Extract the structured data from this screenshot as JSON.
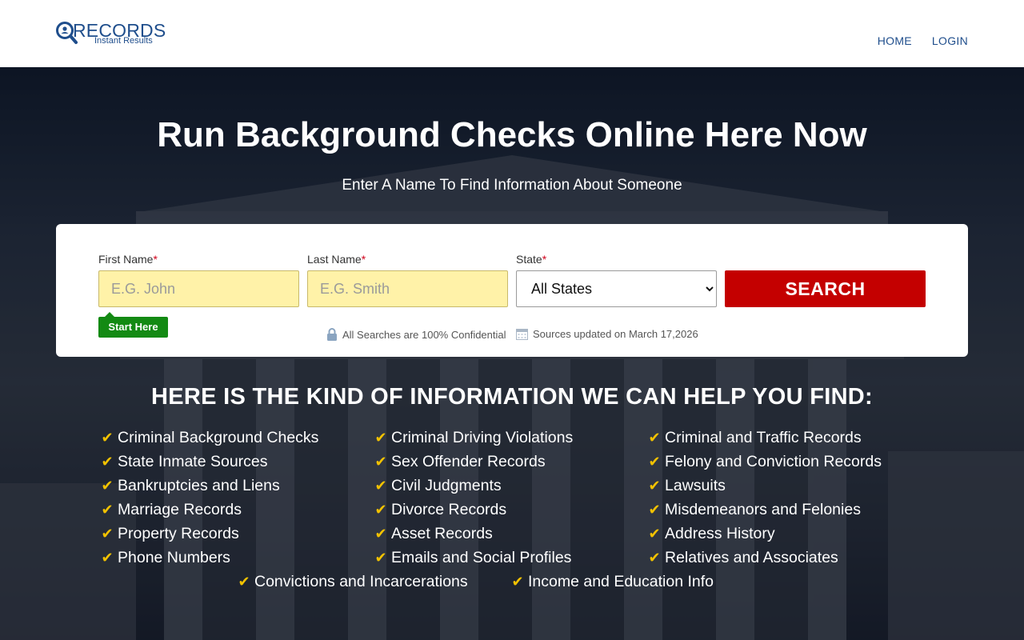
{
  "header": {
    "logo_title": "RECORDS",
    "logo_sub": "Instant Results",
    "nav": [
      "HOME",
      "LOGIN"
    ]
  },
  "hero": {
    "headline": "Run Background Checks Online Here Now",
    "subline": "Enter A Name To Find Information About Someone"
  },
  "form": {
    "first_name_label": "First Name",
    "first_name_placeholder": "E.G. John",
    "last_name_label": "Last Name",
    "last_name_placeholder": "E.G. Smith",
    "state_label": "State",
    "required_marker": "*",
    "state_selected": "All States",
    "search_label": "SEARCH",
    "start_here": "Start Here",
    "confidential_note": "All Searches are 100% Confidential",
    "updated_note": "Sources updated on March 17,2026"
  },
  "info": {
    "title": "HERE IS THE KIND OF INFORMATION WE CAN HELP YOU FIND:",
    "col1": [
      "Criminal Background Checks",
      "State Inmate Sources",
      "Bankruptcies and Liens",
      "Marriage Records",
      "Property Records",
      "Phone Numbers"
    ],
    "col2": [
      "Criminal Driving Violations",
      "Sex Offender Records",
      "Civil Judgments",
      "Divorce Records",
      "Asset Records",
      "Emails and Social Profiles"
    ],
    "col3": [
      "Criminal and Traffic Records",
      "Felony and Conviction Records",
      "Lawsuits",
      "Misdemeanors and Felonies",
      "Address History",
      "Relatives and Associates"
    ],
    "extra": [
      "Convictions and Incarcerations",
      "Income and Education Info"
    ]
  },
  "colors": {
    "brand_blue": "#1f4e8c",
    "search_red": "#c40000",
    "start_green": "#138a13",
    "input_yellow": "#fff2a8",
    "check_gold": "#f2c200"
  },
  "icons": [
    "search-magnifier-logo-icon",
    "lock-icon",
    "calendar-icon",
    "check-icon"
  ]
}
